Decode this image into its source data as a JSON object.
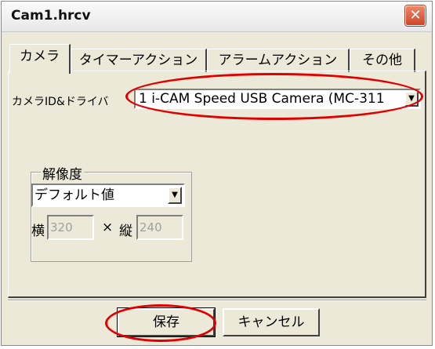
{
  "window": {
    "title": "Cam1.hrcv",
    "close_glyph": "✕"
  },
  "tabs": [
    {
      "label": "カメラ",
      "active": true
    },
    {
      "label": "タイマーアクション",
      "active": false
    },
    {
      "label": "アラームアクション",
      "active": false
    },
    {
      "label": "その他",
      "active": false
    }
  ],
  "camera": {
    "label": "カメラID&ドライバ",
    "selected": "1 i-CAM Speed USB Camera (MC-311",
    "dropdown_glyph": "▼"
  },
  "resolution": {
    "group_title": "解像度",
    "selected": "デフォルト値",
    "dropdown_glyph": "▼",
    "width_label": "横",
    "width_value": "320",
    "times": "×",
    "height_label": "縦",
    "height_value": "240"
  },
  "buttons": {
    "save": "保存",
    "cancel": "キャンセル"
  },
  "annotations": {
    "highlight_color": "#e00000"
  }
}
